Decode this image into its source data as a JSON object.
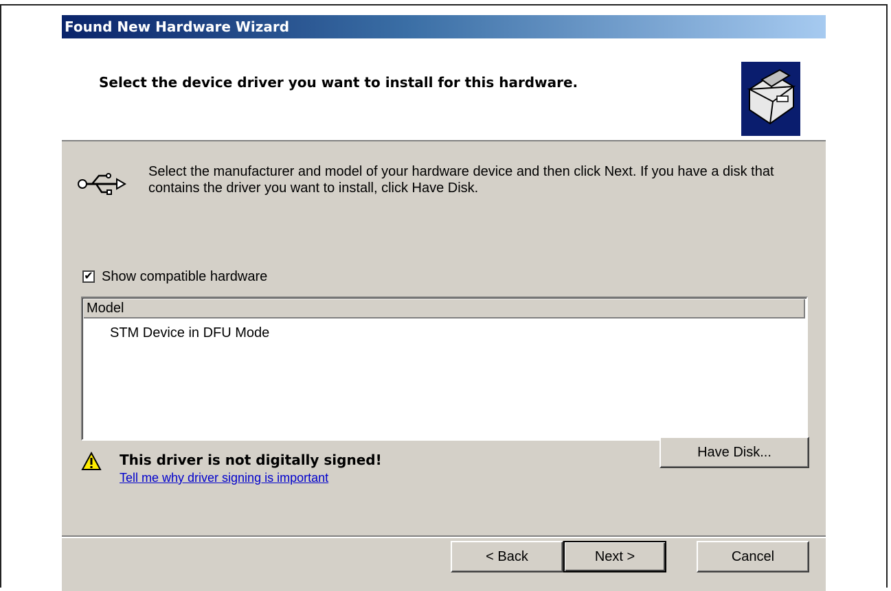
{
  "window": {
    "title": "Found New Hardware Wizard"
  },
  "header": {
    "title": "Select the device driver you want to install for this hardware."
  },
  "intro": {
    "text": "Select the manufacturer and model of your hardware device and then click Next. If you have a disk that contains the driver you want to install, click Have Disk."
  },
  "options": {
    "show_compatible_label": "Show compatible hardware",
    "show_compatible_checked": true
  },
  "model_list": {
    "column_header": "Model",
    "items": [
      "STM Device in DFU Mode"
    ]
  },
  "warning": {
    "text": "This driver is not digitally signed!",
    "link": "Tell me why driver signing is important"
  },
  "buttons": {
    "have_disk": "Have Disk...",
    "back": "< Back",
    "next": "Next >",
    "cancel": "Cancel"
  },
  "icons": {
    "header": "hardware-box-icon",
    "device": "usb-icon",
    "warning": "warning-icon"
  }
}
